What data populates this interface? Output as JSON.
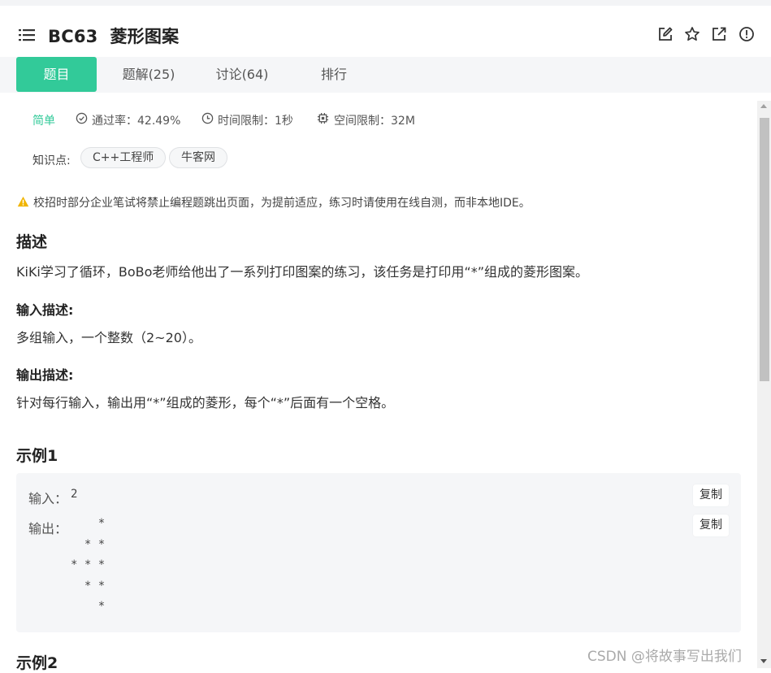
{
  "header": {
    "title": "BC63  菱形图案",
    "icons": [
      "list-icon",
      "edit-icon",
      "star-icon",
      "share-icon",
      "info-icon"
    ]
  },
  "tabs": [
    {
      "label": "题目",
      "active": true
    },
    {
      "label": "题解(25)",
      "active": false
    },
    {
      "label": "讨论(64)",
      "active": false
    },
    {
      "label": "排行",
      "active": false
    }
  ],
  "meta": {
    "level": "简单",
    "pass_rate": "通过率：42.49%",
    "time_limit": "时间限制：1秒",
    "space_limit": "空间限制：32M"
  },
  "knowledge": {
    "label": "知识点:",
    "tags": [
      "C++工程师",
      "牛客网"
    ]
  },
  "notice": "校招时部分企业笔试将禁止编程题跳出页面，为提前适应，练习时请使用在线自测，而非本地IDE。",
  "description": {
    "heading": "描述",
    "text": "KiKi学习了循环，BoBo老师给他出了一系列打印图案的练习，该任务是打印用“*”组成的菱形图案。"
  },
  "input_desc": {
    "heading": "输入描述:",
    "text": "多组输入，一个整数（2~20）。"
  },
  "output_desc": {
    "heading": "输出描述:",
    "text": "针对每行输入，输出用“*”组成的菱形，每个“*”后面有一个空格。"
  },
  "example1": {
    "heading": "示例1",
    "input_label": "输入：",
    "input_value": "2",
    "output_label": "输出：",
    "output_value": "    * \n  * * \n* * * \n  * * \n    * ",
    "copy_label": "复制"
  },
  "example2": {
    "heading": "示例2"
  },
  "watermark": "CSDN @将故事写出我们",
  "colors": {
    "accent": "#32ca99",
    "warning": "#f0b400"
  }
}
